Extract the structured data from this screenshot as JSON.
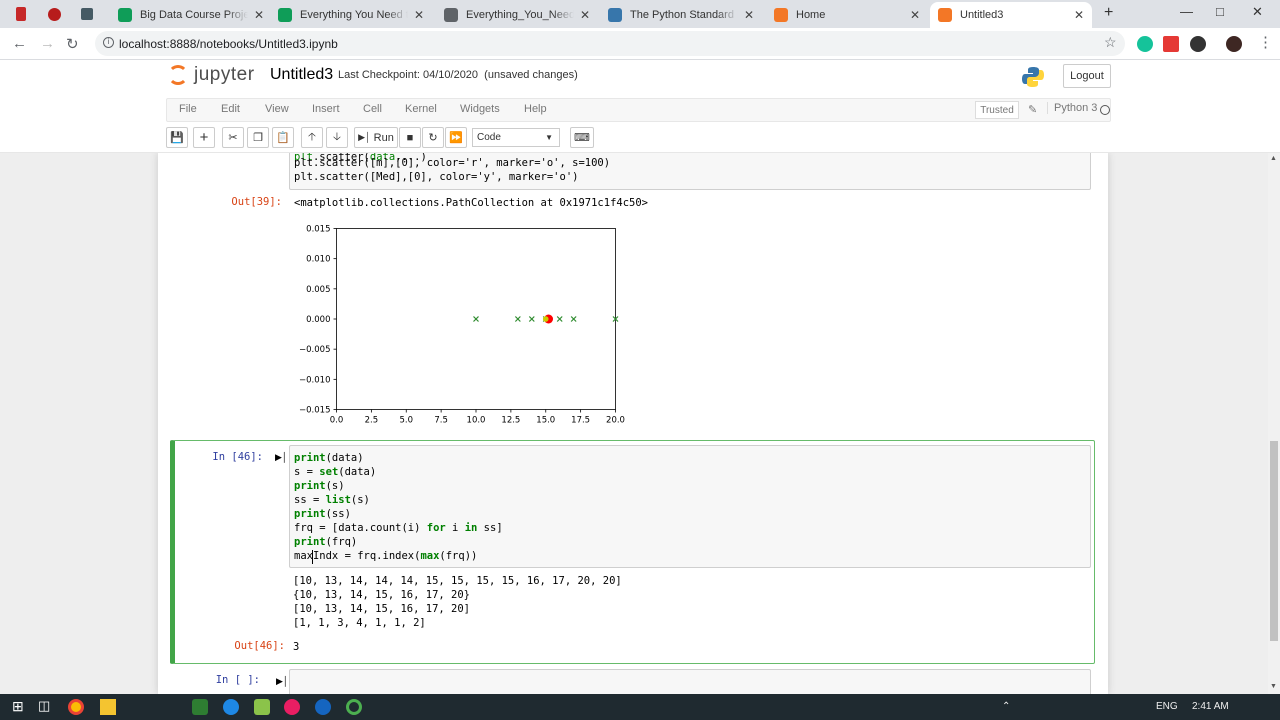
{
  "browser": {
    "tabs": [
      {
        "title": "Big Data Course Project -",
        "color": "#0f9d58"
      },
      {
        "title": "Everything You Need to k",
        "color": "#0f9d58"
      },
      {
        "title": "Everything_You_Need_to",
        "color": "#5f6368"
      },
      {
        "title": "The Python Standard Libr",
        "color": "#3776ab"
      },
      {
        "title": "Home",
        "color": "#f37726"
      },
      {
        "title": "Untitled3",
        "color": "#f37726",
        "active": true
      }
    ],
    "url": "localhost:8888/notebooks/Untitled3.ipynb"
  },
  "jupyter": {
    "logo_text": "jupyter",
    "notebook_name": "Untitled3",
    "checkpoint": "Last Checkpoint: 04/10/2020",
    "unsaved": "(unsaved changes)",
    "logout": "Logout",
    "menus": [
      "File",
      "Edit",
      "View",
      "Insert",
      "Cell",
      "Kernel",
      "Widgets",
      "Help"
    ],
    "trusted": "Trusted",
    "kernel": "Python 3",
    "run_label": "Run",
    "cell_type": "Code"
  },
  "cells": {
    "cell1_code_partial": [
      "plt.scatter([m],[0], color='r', marker='o', s=100)",
      "plt.scatter([Med],[0], color='y', marker='o')"
    ],
    "cell1_out_prompt": "Out[39]:",
    "cell1_out_text": "<matplotlib.collections.PathCollection at 0x1971c1f4c50>",
    "cell2_in_prompt": "In [46]:",
    "cell2_code": [
      "print(data)",
      "s = set(data)",
      "print(s)",
      "ss = list(s)",
      "print(ss)",
      "frq = [data.count(i) for i in ss]",
      "print(frq)",
      "maxIndx = frq.index(max(frq))"
    ],
    "cell2_stdout": [
      "[10, 13, 14, 14, 14, 15, 15, 15, 15, 16, 17, 20, 20]",
      "{10, 13, 14, 15, 16, 17, 20}",
      "[10, 13, 14, 15, 16, 17, 20]",
      "[1, 1, 3, 4, 1, 1, 2]"
    ],
    "cell2_out_prompt": "Out[46]:",
    "cell2_out_value": "3",
    "cell3_in_prompt": "In [ ]:"
  },
  "chart_data": {
    "type": "scatter",
    "xlim": [
      0,
      20
    ],
    "ylim": [
      -0.015,
      0.015
    ],
    "xticks": [
      "0.0",
      "2.5",
      "5.0",
      "7.5",
      "10.0",
      "12.5",
      "15.0",
      "17.5",
      "20.0"
    ],
    "yticks": [
      "0.015",
      "0.010",
      "0.005",
      "0.000",
      "−0.005",
      "−0.010",
      "−0.015"
    ],
    "series": [
      {
        "marker": "x",
        "color": "#2e8b2e",
        "points": [
          [
            10,
            0
          ],
          [
            13,
            0
          ],
          [
            14,
            0
          ],
          [
            15,
            0
          ],
          [
            16,
            0
          ],
          [
            17,
            0
          ],
          [
            20,
            0
          ]
        ]
      },
      {
        "marker": "o",
        "color": "#ff0000",
        "size": "large",
        "points": [
          [
            15.2,
            0
          ]
        ]
      },
      {
        "marker": "o",
        "color": "#cccc00",
        "size": "small",
        "points": [
          [
            15,
            0
          ]
        ]
      }
    ]
  },
  "clock": {
    "time": "2:41 AM",
    "lang": "ENG"
  }
}
